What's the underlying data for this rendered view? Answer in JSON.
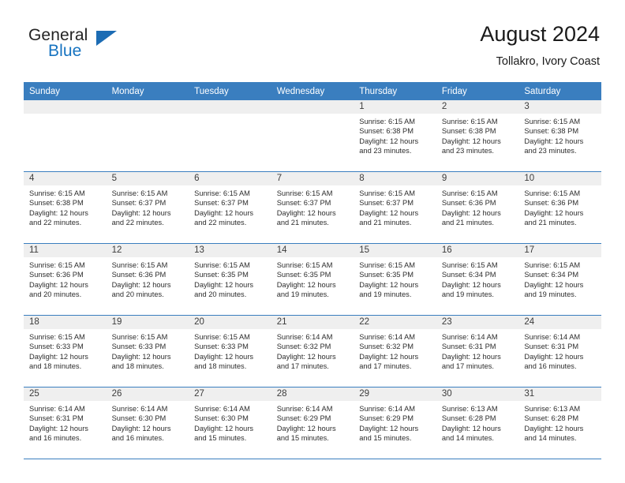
{
  "brand": {
    "name_part1": "General",
    "name_part2": "Blue",
    "triangle_icon": "triangle-logo-icon",
    "accent_color": "#1c6cb4"
  },
  "header": {
    "title": "August 2024",
    "subtitle": "Tollakro, Ivory Coast"
  },
  "theme": {
    "header_blue": "#3a7ebf",
    "daynum_band": "#efefef",
    "cell_background": "#ffffff",
    "text_color": "#2d2d2d"
  },
  "weekday_headers": [
    "Sunday",
    "Monday",
    "Tuesday",
    "Wednesday",
    "Thursday",
    "Friday",
    "Saturday"
  ],
  "weeks": [
    [
      {
        "day": "",
        "empty": true
      },
      {
        "day": "",
        "empty": true
      },
      {
        "day": "",
        "empty": true
      },
      {
        "day": "",
        "empty": true
      },
      {
        "day": "1",
        "sunrise": "Sunrise: 6:15 AM",
        "sunset": "Sunset: 6:38 PM",
        "daylight": "Daylight: 12 hours and 23 minutes."
      },
      {
        "day": "2",
        "sunrise": "Sunrise: 6:15 AM",
        "sunset": "Sunset: 6:38 PM",
        "daylight": "Daylight: 12 hours and 23 minutes."
      },
      {
        "day": "3",
        "sunrise": "Sunrise: 6:15 AM",
        "sunset": "Sunset: 6:38 PM",
        "daylight": "Daylight: 12 hours and 23 minutes."
      }
    ],
    [
      {
        "day": "4",
        "sunrise": "Sunrise: 6:15 AM",
        "sunset": "Sunset: 6:38 PM",
        "daylight": "Daylight: 12 hours and 22 minutes."
      },
      {
        "day": "5",
        "sunrise": "Sunrise: 6:15 AM",
        "sunset": "Sunset: 6:37 PM",
        "daylight": "Daylight: 12 hours and 22 minutes."
      },
      {
        "day": "6",
        "sunrise": "Sunrise: 6:15 AM",
        "sunset": "Sunset: 6:37 PM",
        "daylight": "Daylight: 12 hours and 22 minutes."
      },
      {
        "day": "7",
        "sunrise": "Sunrise: 6:15 AM",
        "sunset": "Sunset: 6:37 PM",
        "daylight": "Daylight: 12 hours and 21 minutes."
      },
      {
        "day": "8",
        "sunrise": "Sunrise: 6:15 AM",
        "sunset": "Sunset: 6:37 PM",
        "daylight": "Daylight: 12 hours and 21 minutes."
      },
      {
        "day": "9",
        "sunrise": "Sunrise: 6:15 AM",
        "sunset": "Sunset: 6:36 PM",
        "daylight": "Daylight: 12 hours and 21 minutes."
      },
      {
        "day": "10",
        "sunrise": "Sunrise: 6:15 AM",
        "sunset": "Sunset: 6:36 PM",
        "daylight": "Daylight: 12 hours and 21 minutes."
      }
    ],
    [
      {
        "day": "11",
        "sunrise": "Sunrise: 6:15 AM",
        "sunset": "Sunset: 6:36 PM",
        "daylight": "Daylight: 12 hours and 20 minutes."
      },
      {
        "day": "12",
        "sunrise": "Sunrise: 6:15 AM",
        "sunset": "Sunset: 6:36 PM",
        "daylight": "Daylight: 12 hours and 20 minutes."
      },
      {
        "day": "13",
        "sunrise": "Sunrise: 6:15 AM",
        "sunset": "Sunset: 6:35 PM",
        "daylight": "Daylight: 12 hours and 20 minutes."
      },
      {
        "day": "14",
        "sunrise": "Sunrise: 6:15 AM",
        "sunset": "Sunset: 6:35 PM",
        "daylight": "Daylight: 12 hours and 19 minutes."
      },
      {
        "day": "15",
        "sunrise": "Sunrise: 6:15 AM",
        "sunset": "Sunset: 6:35 PM",
        "daylight": "Daylight: 12 hours and 19 minutes."
      },
      {
        "day": "16",
        "sunrise": "Sunrise: 6:15 AM",
        "sunset": "Sunset: 6:34 PM",
        "daylight": "Daylight: 12 hours and 19 minutes."
      },
      {
        "day": "17",
        "sunrise": "Sunrise: 6:15 AM",
        "sunset": "Sunset: 6:34 PM",
        "daylight": "Daylight: 12 hours and 19 minutes."
      }
    ],
    [
      {
        "day": "18",
        "sunrise": "Sunrise: 6:15 AM",
        "sunset": "Sunset: 6:33 PM",
        "daylight": "Daylight: 12 hours and 18 minutes."
      },
      {
        "day": "19",
        "sunrise": "Sunrise: 6:15 AM",
        "sunset": "Sunset: 6:33 PM",
        "daylight": "Daylight: 12 hours and 18 minutes."
      },
      {
        "day": "20",
        "sunrise": "Sunrise: 6:15 AM",
        "sunset": "Sunset: 6:33 PM",
        "daylight": "Daylight: 12 hours and 18 minutes."
      },
      {
        "day": "21",
        "sunrise": "Sunrise: 6:14 AM",
        "sunset": "Sunset: 6:32 PM",
        "daylight": "Daylight: 12 hours and 17 minutes."
      },
      {
        "day": "22",
        "sunrise": "Sunrise: 6:14 AM",
        "sunset": "Sunset: 6:32 PM",
        "daylight": "Daylight: 12 hours and 17 minutes."
      },
      {
        "day": "23",
        "sunrise": "Sunrise: 6:14 AM",
        "sunset": "Sunset: 6:31 PM",
        "daylight": "Daylight: 12 hours and 17 minutes."
      },
      {
        "day": "24",
        "sunrise": "Sunrise: 6:14 AM",
        "sunset": "Sunset: 6:31 PM",
        "daylight": "Daylight: 12 hours and 16 minutes."
      }
    ],
    [
      {
        "day": "25",
        "sunrise": "Sunrise: 6:14 AM",
        "sunset": "Sunset: 6:31 PM",
        "daylight": "Daylight: 12 hours and 16 minutes."
      },
      {
        "day": "26",
        "sunrise": "Sunrise: 6:14 AM",
        "sunset": "Sunset: 6:30 PM",
        "daylight": "Daylight: 12 hours and 16 minutes."
      },
      {
        "day": "27",
        "sunrise": "Sunrise: 6:14 AM",
        "sunset": "Sunset: 6:30 PM",
        "daylight": "Daylight: 12 hours and 15 minutes."
      },
      {
        "day": "28",
        "sunrise": "Sunrise: 6:14 AM",
        "sunset": "Sunset: 6:29 PM",
        "daylight": "Daylight: 12 hours and 15 minutes."
      },
      {
        "day": "29",
        "sunrise": "Sunrise: 6:14 AM",
        "sunset": "Sunset: 6:29 PM",
        "daylight": "Daylight: 12 hours and 15 minutes."
      },
      {
        "day": "30",
        "sunrise": "Sunrise: 6:13 AM",
        "sunset": "Sunset: 6:28 PM",
        "daylight": "Daylight: 12 hours and 14 minutes."
      },
      {
        "day": "31",
        "sunrise": "Sunrise: 6:13 AM",
        "sunset": "Sunset: 6:28 PM",
        "daylight": "Daylight: 12 hours and 14 minutes."
      }
    ]
  ]
}
